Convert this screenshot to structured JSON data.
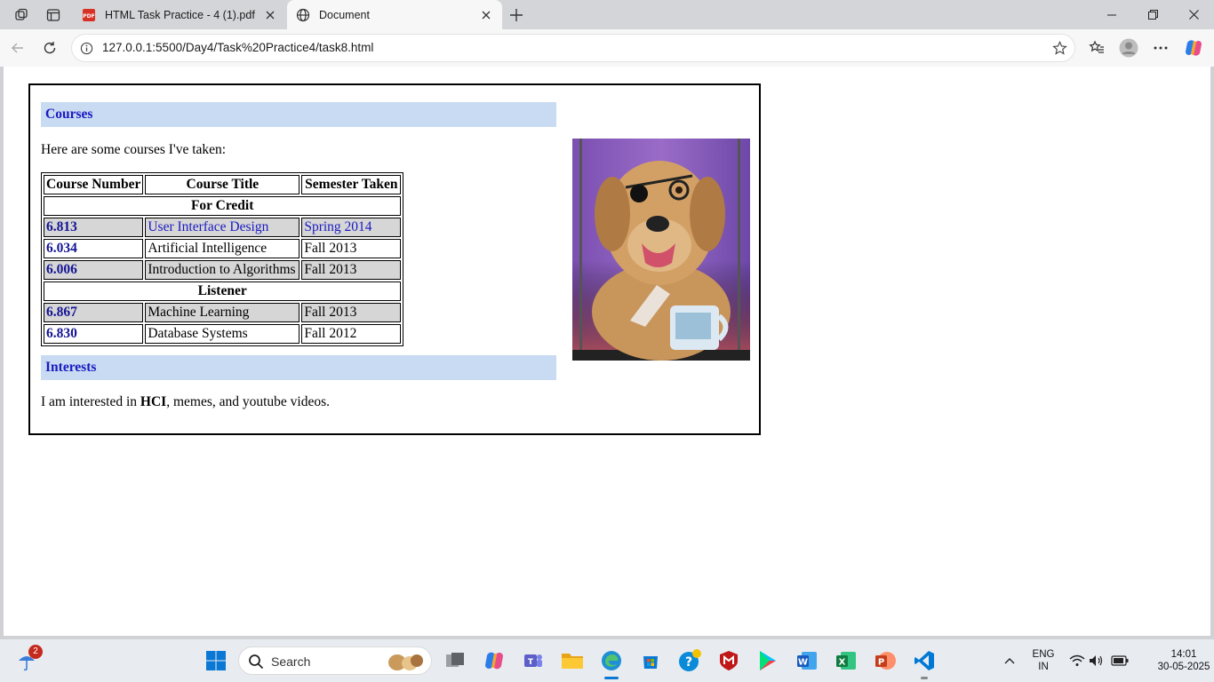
{
  "browser": {
    "tabs": [
      {
        "title": "HTML Task Practice - 4 (1).pdf",
        "icon": "pdf-icon",
        "active": false
      },
      {
        "title": "Document",
        "icon": "globe-icon",
        "active": true
      }
    ],
    "url": "127.0.0.1:5500/Day4/Task%20Practice4/task8.html"
  },
  "page": {
    "courses_heading": "Courses",
    "intro": "Here are some courses I've taken:",
    "table": {
      "headers": [
        "Course Number",
        "Course Title",
        "Semester Taken"
      ],
      "groups": [
        {
          "label": "For Credit",
          "rows": [
            {
              "num": "6.813",
              "title": "User Interface Design",
              "sem": "Spring 2014",
              "linked": true
            },
            {
              "num": "6.034",
              "title": "Artificial Intelligence",
              "sem": "Fall 2013",
              "linked": false
            },
            {
              "num": "6.006",
              "title": "Introduction to Algorithms",
              "sem": "Fall 2013",
              "linked": false
            }
          ]
        },
        {
          "label": "Listener",
          "rows": [
            {
              "num": "6.867",
              "title": "Machine Learning",
              "sem": "Fall 2013",
              "linked": false
            },
            {
              "num": "6.830",
              "title": "Database Systems",
              "sem": "Fall 2012",
              "linked": false
            }
          ]
        }
      ]
    },
    "interests_heading": "Interests",
    "interests": {
      "before": "I am interested in ",
      "bold": "HCI",
      "after": ", memes, and youtube videos."
    },
    "image": "dog-with-glasses-photo"
  },
  "taskbar": {
    "search_placeholder": "Search",
    "weather_badge": "2",
    "lang_line1": "ENG",
    "lang_line2": "IN",
    "time": "14:01",
    "date": "30-05-2025"
  },
  "colors": {
    "heading_bg": "#c8dbf2",
    "heading_text": "#1a1ac2",
    "row_grey": "#d6d6d6"
  }
}
